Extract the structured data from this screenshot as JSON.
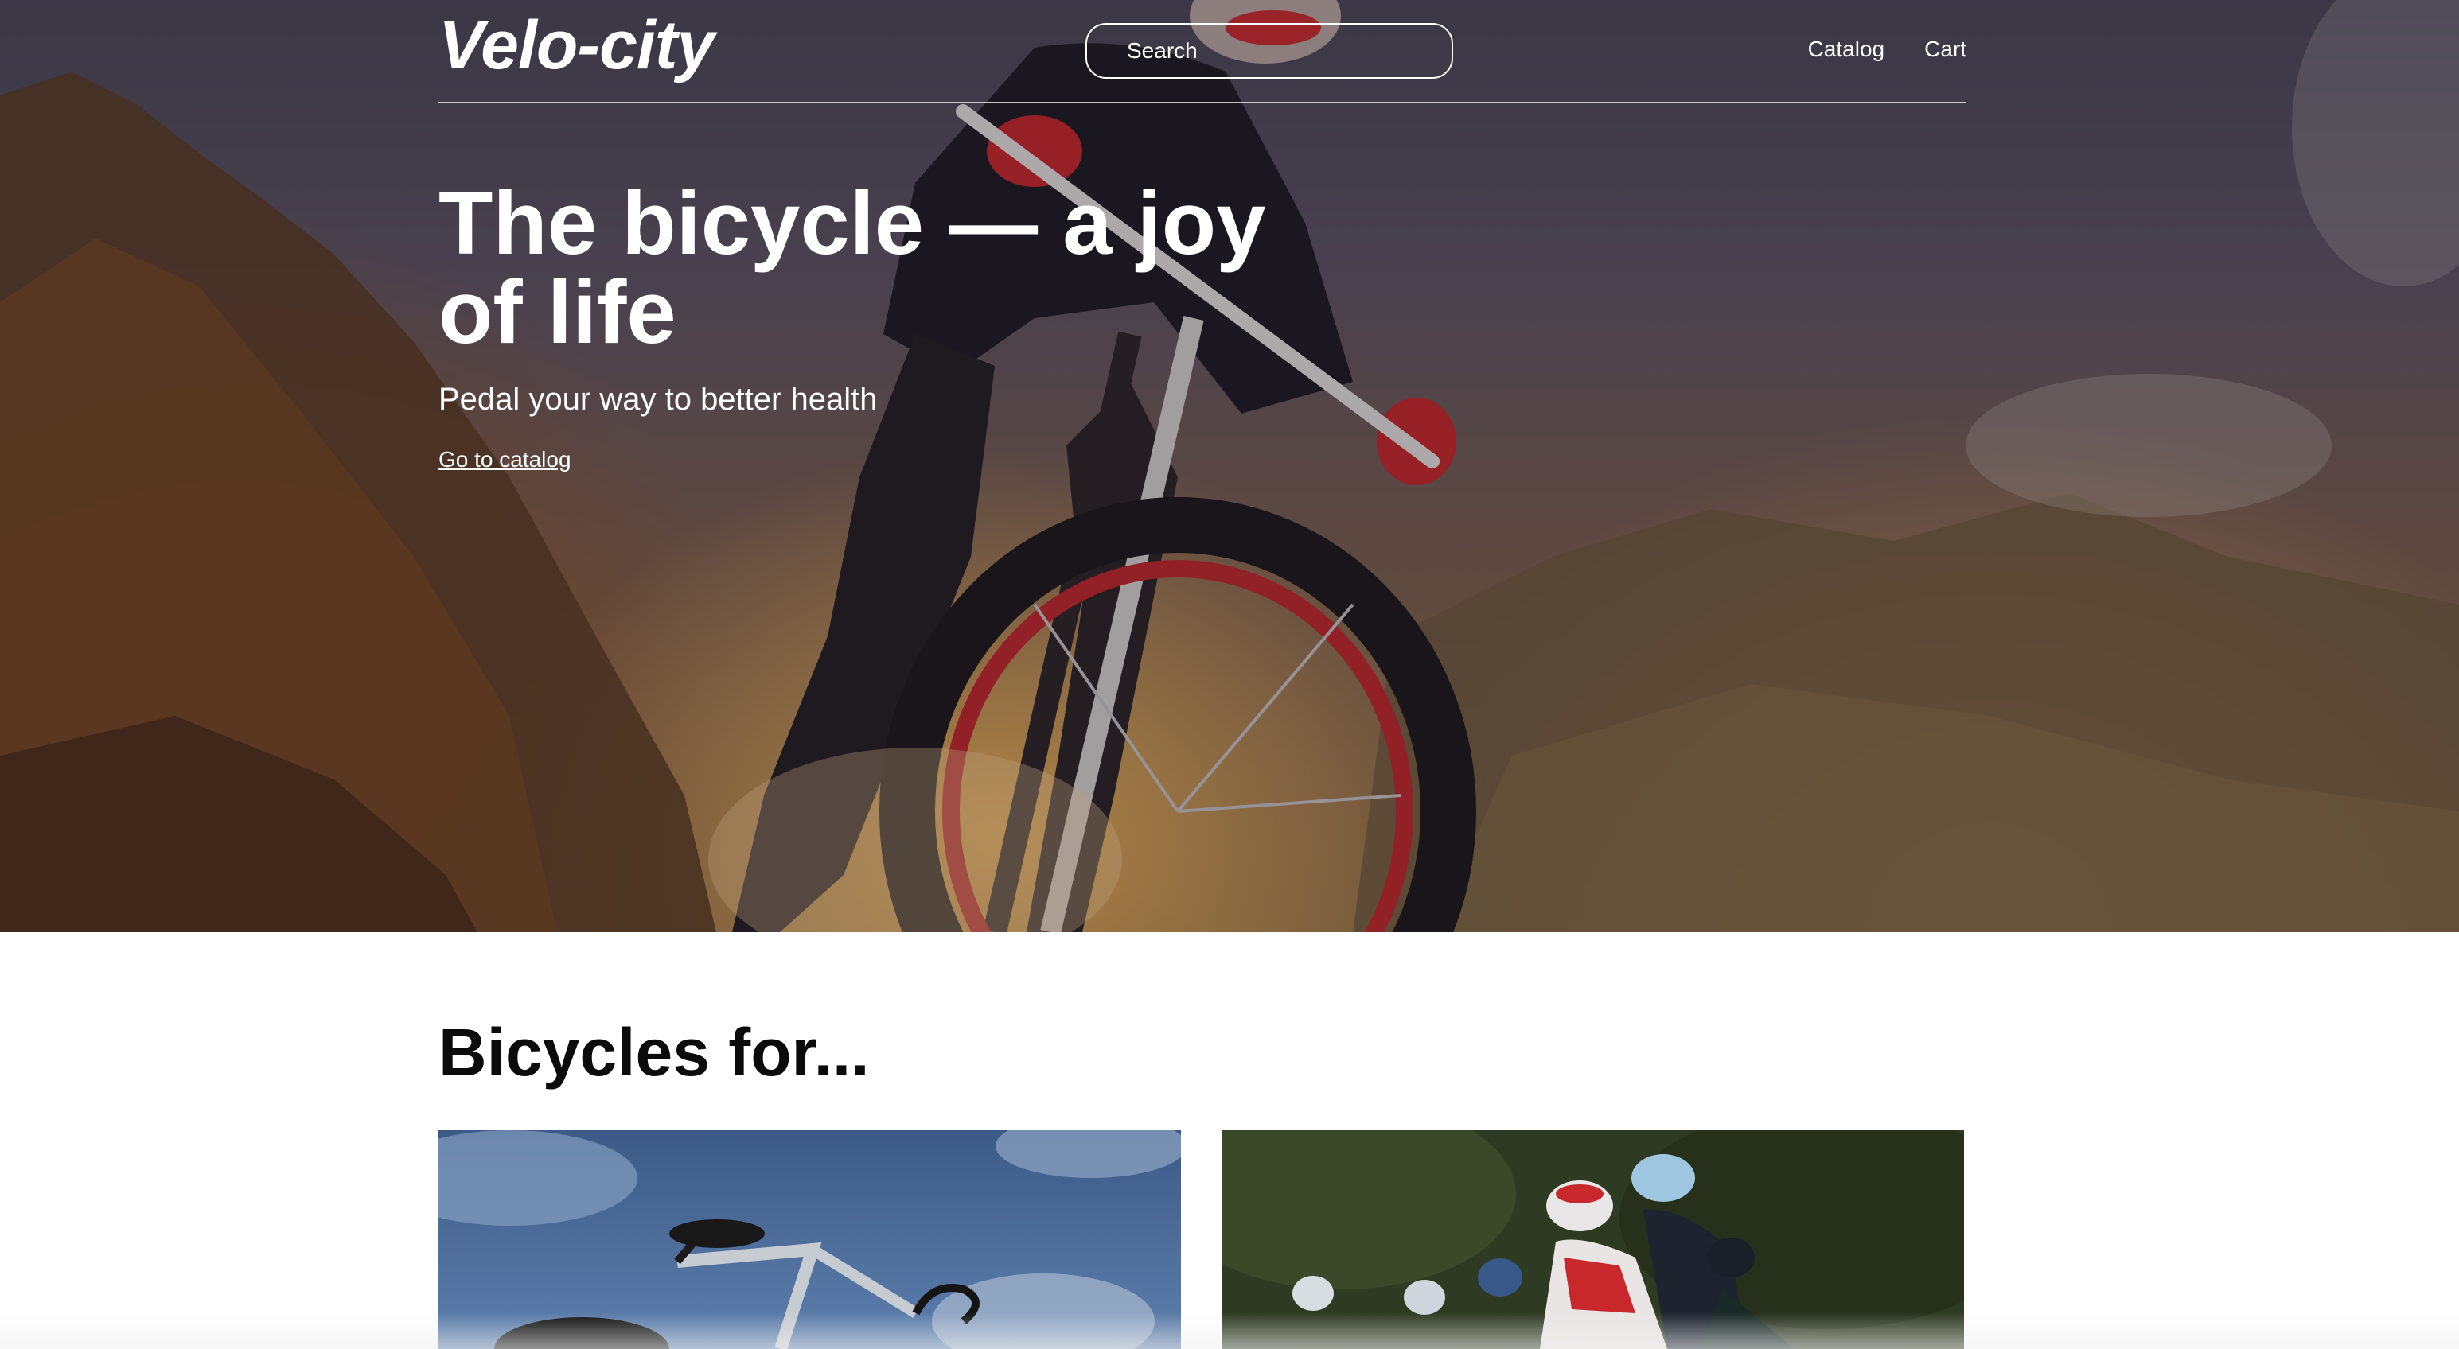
{
  "header": {
    "logo": "Velo-city",
    "search_placeholder": "Search",
    "nav": [
      "Catalog",
      "Cart"
    ]
  },
  "hero": {
    "title": "The bicycle — a joy of life",
    "subtitle": "Pedal your way to better health",
    "link": "Go to catalog"
  },
  "section": {
    "title": "Bicycles for..."
  },
  "colors": {
    "text_on_dark": "#ffffff",
    "text_dark": "#0b0b0b"
  }
}
